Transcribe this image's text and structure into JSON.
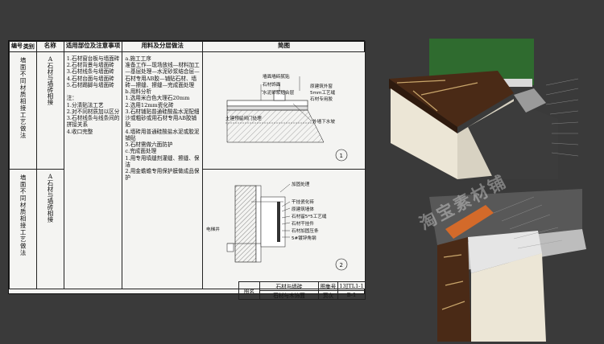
{
  "table": {
    "headers": {
      "code_top": "编号",
      "code_bottom": "类别",
      "name": "名称",
      "scope": "适用部位及注意事项",
      "materials": "用料及分层做法",
      "sketch": "简图"
    },
    "rows": [
      {
        "category": "墙面不同材质相接工艺做法",
        "name": "A石材与墙砖相接",
        "scope": [
          "1.石材窗台板与墙面砖",
          "2.石材背景与墙面砖",
          "3.石材线条与墙面砖",
          "4.石材台面与墙面砖",
          "5.石材踢脚与墙面砖",
          "",
          "注：",
          "1.分清贴法工艺",
          "2.对不同材质加以区分",
          "3.石材线条与线条间的拼接关系",
          "4.收口完整"
        ],
        "materials": [
          "a.施工工序",
          "准备工作—现场放线—材料加工—基层处理—水泥砂浆结合层—石材专用AB胶—铺贴石材、墙砖—擦缝、擦缝—完成面处理",
          "b.用料分析",
          "1.选用米白色大理石20mm",
          "2.选用12mm瓷化砖",
          "3.石材铺贴普通硅酸盐水泥配细沙或粗砂或用石材专用AB胶铺贴",
          "4.墙砖用普通硅酸盐水泥或胶泥铺贴",
          "5.石材需做六面防护",
          "c.完成面处理",
          "1.用专用填缝剂灌缝、擦缝、保洁",
          "2.用金蟾蟾专用保护膜做成品保护"
        ]
      },
      {
        "category": "墙面不同材质相接工艺做法",
        "name": "A石材与墙砖相接"
      }
    ]
  },
  "drawing1": {
    "labels": [
      "墙面墙砖腻贴",
      "石材饰面",
      "水泥砂浆结合层",
      "原建筑外窗",
      "5mm工艺缝",
      "石材专用胶",
      "外墙下水坡",
      "土建预留阀门处理"
    ],
    "number": "1"
  },
  "drawing2": {
    "labels": [
      "加固处理",
      "干挂瓷化砖",
      "原建筑墙体",
      "石材留5*5工艺缝",
      "石材干挂件",
      "石材加固压条",
      "5#镀锌角钢",
      "电梯井"
    ],
    "number": "2"
  },
  "title_block": {
    "label_name": "图名",
    "name_line1": "石材与墙砖",
    "name_line2": "石材与木饰面",
    "label_code": "图集号",
    "code": "13JTL1-1",
    "label_page": "页次",
    "page": "B-1"
  },
  "watermark": "淘宝素材铺",
  "colors": {
    "background": "#3a3a3a",
    "sheet": "#f4f4f2",
    "marble_dark": "#4a2a16",
    "marble_light": "#ece6d6",
    "stone_grey": "#6e6e6e",
    "green_wall": "#2f6b2f"
  }
}
